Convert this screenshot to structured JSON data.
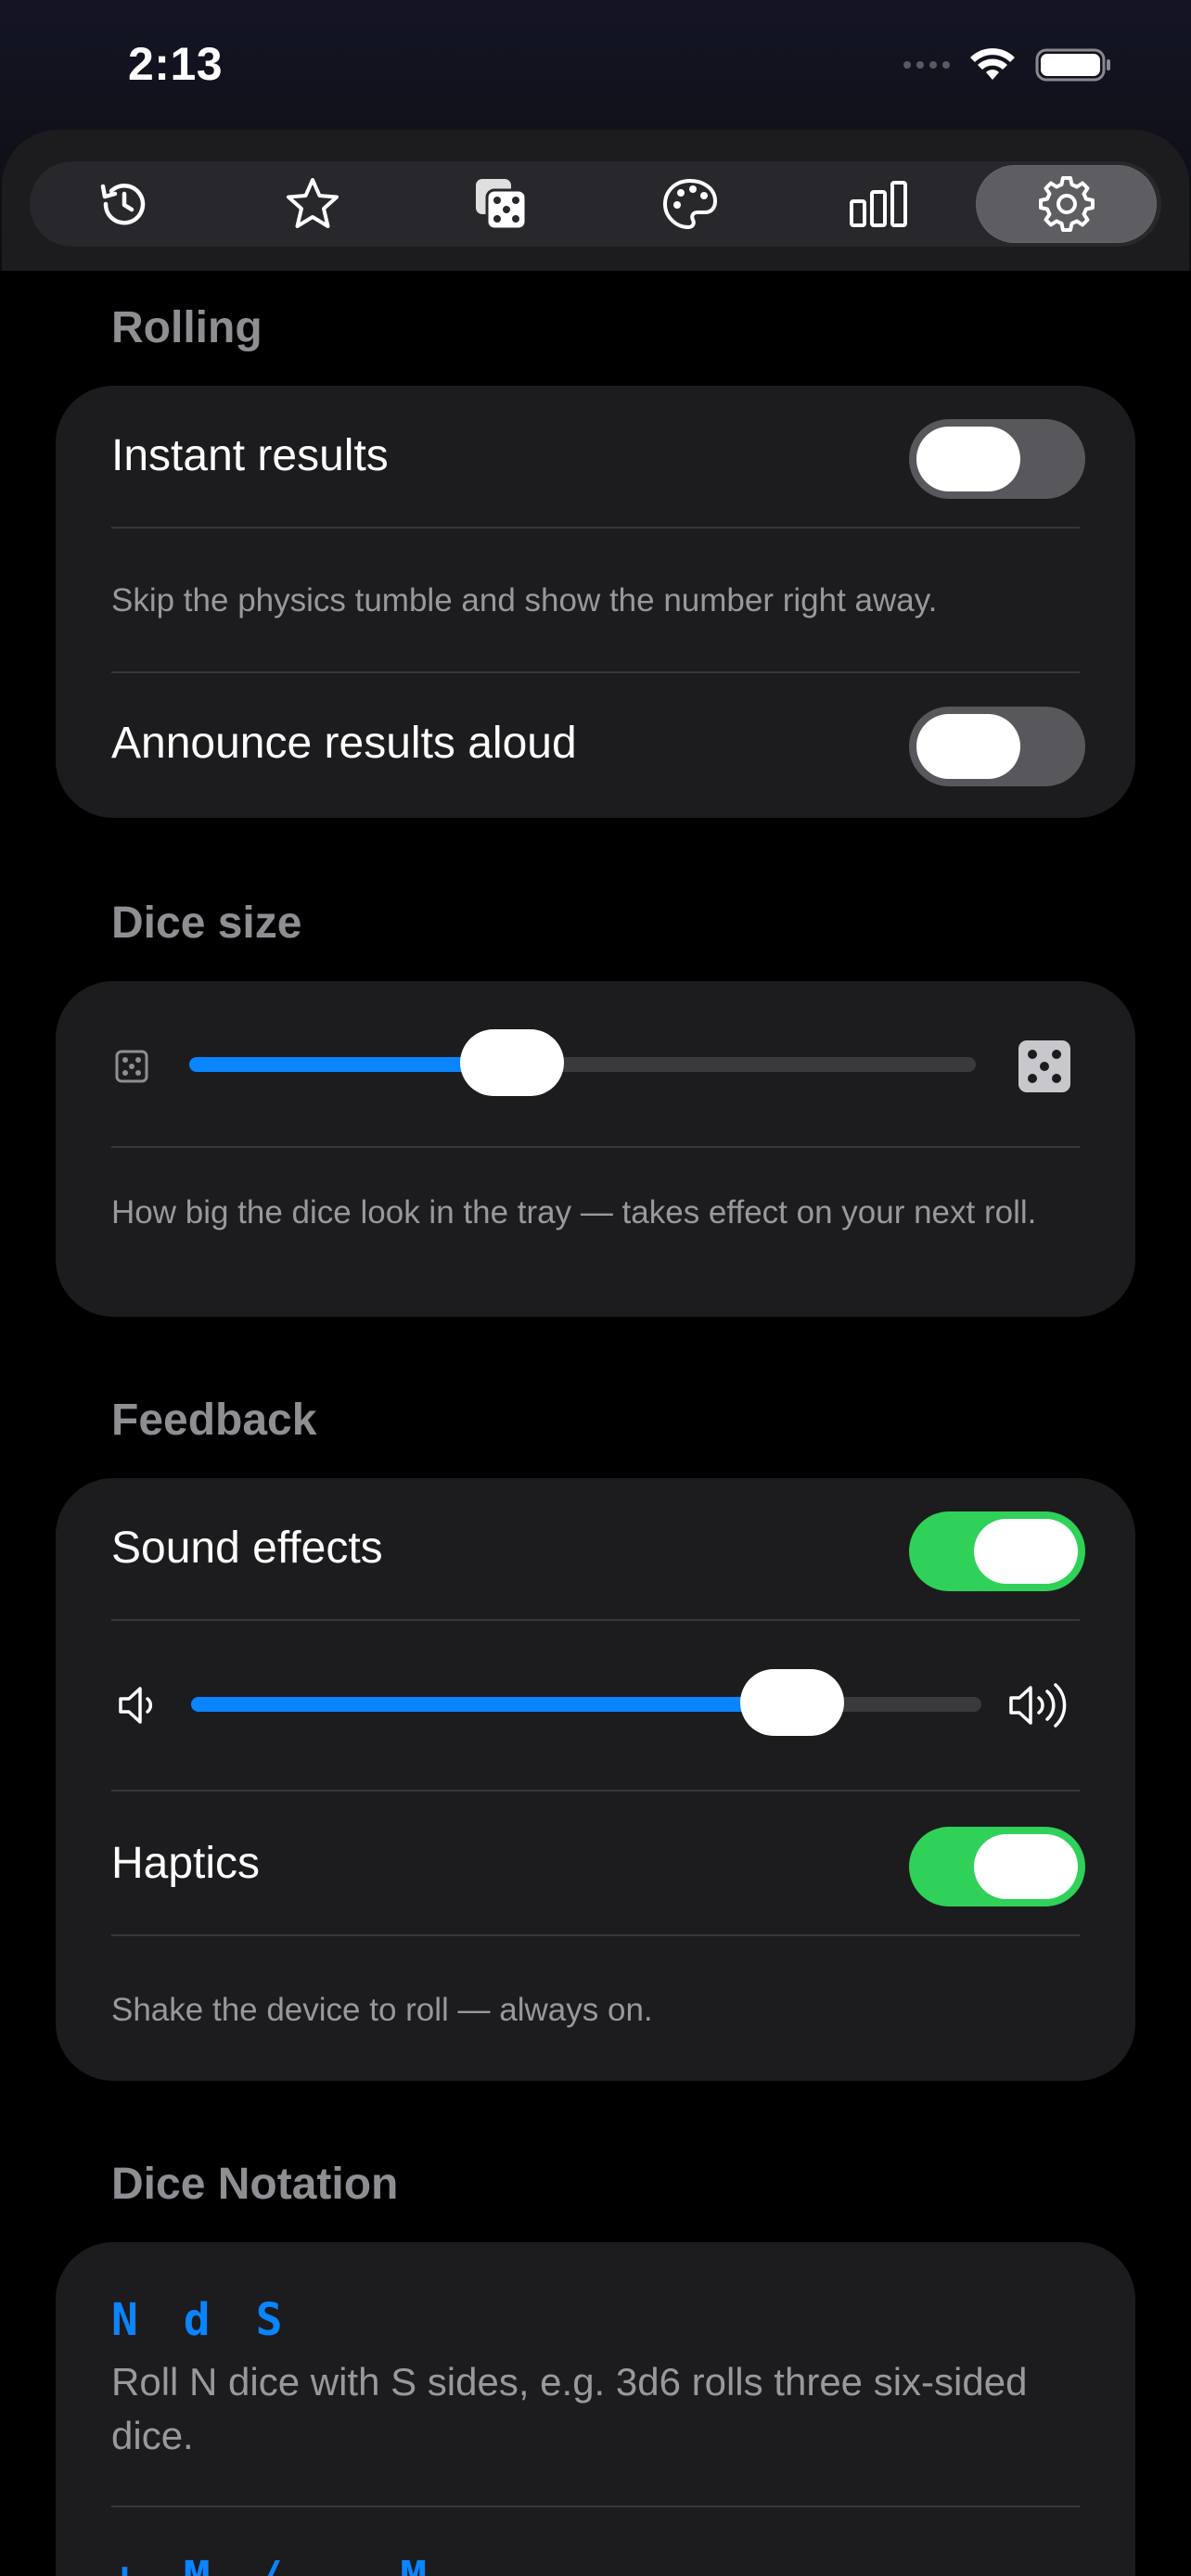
{
  "status": {
    "time": "2:13"
  },
  "tabs": [
    {
      "icon": "history-icon",
      "active": false
    },
    {
      "icon": "star-icon",
      "active": false
    },
    {
      "icon": "dice-icon",
      "active": false
    },
    {
      "icon": "palette-icon",
      "active": false
    },
    {
      "icon": "stats-icon",
      "active": false
    },
    {
      "icon": "gear-icon",
      "active": true
    }
  ],
  "rolling": {
    "title": "Rolling",
    "instant_label": "Instant results",
    "instant_on": false,
    "instant_desc": "Skip the physics tumble and show the number right away.",
    "announce_label": "Announce results aloud",
    "announce_on": false
  },
  "dice_size": {
    "title": "Dice size",
    "value": 0.41,
    "desc": "How big the dice look in the tray — takes effect on your next roll."
  },
  "feedback": {
    "title": "Feedback",
    "sound_label": "Sound effects",
    "sound_on": true,
    "volume": 0.76,
    "haptics_label": "Haptics",
    "haptics_on": true,
    "desc": "Shake the device to roll — always on."
  },
  "notation": {
    "title": "Dice Notation",
    "items": [
      {
        "syntax": "N d S",
        "desc": "Roll N dice with S sides, e.g. 3d6 rolls three six-sided dice."
      },
      {
        "syntax": "+ M  /  − M",
        "desc": ""
      }
    ]
  },
  "colors": {
    "accent": "#0a84ff",
    "toggle_on": "#30d158",
    "card": "#1c1c1e"
  }
}
